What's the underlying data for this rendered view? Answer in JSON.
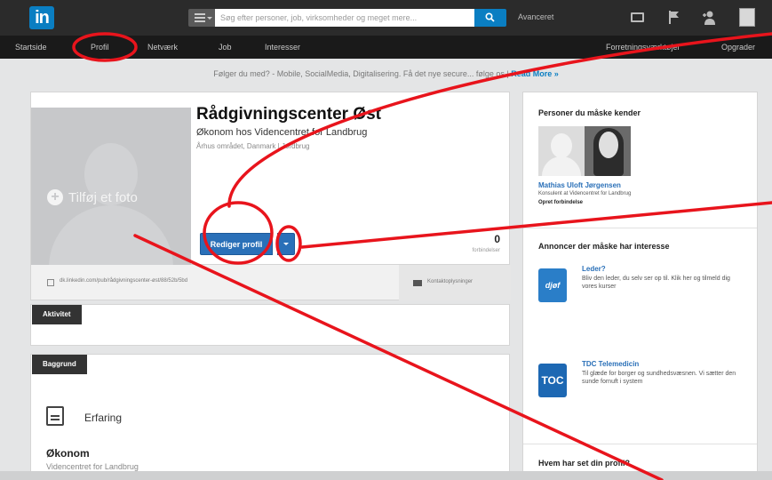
{
  "header": {
    "logo": "in",
    "search_placeholder": "Søg efter personer, job, virksomheder og meget mere...",
    "advanced_label": "Avanceret"
  },
  "nav": {
    "items": [
      "Startside",
      "Profil",
      "Netværk",
      "Job",
      "Interesser"
    ],
    "right_items": [
      "Forretningsværktøjer",
      "Opgrader"
    ]
  },
  "promo": {
    "text": "Følger du med? - Mobile, SocialMedia, Digitalisering. Få det nye secure... følge os |",
    "read_more": "Read More »"
  },
  "profile": {
    "add_photo_label": "Tilføj et foto",
    "name": "Rådgivningscenter Øst",
    "headline": "Økonom hos Videncentret for Landbrug",
    "location": "Århus området, Danmark",
    "industry": "Jordbrug",
    "location_separator": "|",
    "edit_button_label": "Rediger profil",
    "connections_count": "0",
    "connections_label": "forbindelser",
    "public_url": "dk.linkedin.com/pub/rådgivningscenter-øst/88/52b/5bd",
    "contact_label": "Kontaktoplysninger"
  },
  "sections": {
    "activity_label": "Aktivitet",
    "background_label": "Baggrund",
    "experience_title": "Erfaring",
    "position_title": "Økonom",
    "position_company": "Videncentret for Landbrug"
  },
  "sidebar": {
    "pymk_title": "Personer du måske kender",
    "pymk_name": "Mathias Uloft Jørgensen",
    "pymk_headline": "Konsulent at Videncentret for Landbrug",
    "pymk_action": "Opret forbindelse",
    "ads_title": "Annoncer der måske har interesse",
    "ads": [
      {
        "logo": "djøf",
        "title": "Leder?",
        "body": "Bliv den leder, du selv ser op til. Klik her og tilmeld dig vores kurser"
      },
      {
        "logo": "TOC",
        "title": "TDC Telemedicin",
        "body": "Til glæde for borger og sundhedsvæsnen. Vi sætter den sunde fornuft i system"
      }
    ],
    "viewers_title": "Hvem har set din profil?"
  },
  "colors": {
    "linkedin_blue": "#0a7ec2",
    "button_blue": "#2a70b8",
    "annotation_red": "#e8141c",
    "header_bg": "#2b2b2b"
  }
}
